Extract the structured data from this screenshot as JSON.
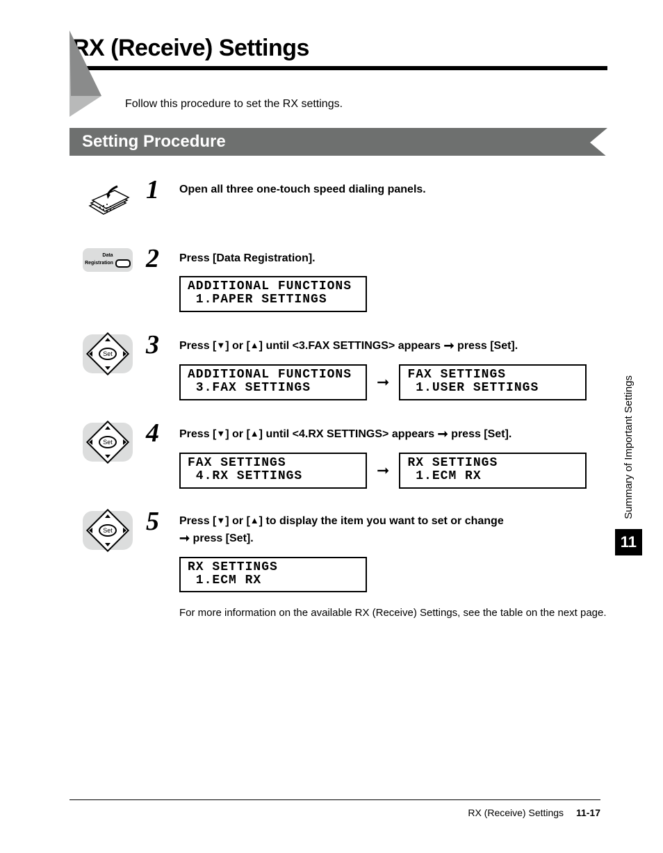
{
  "chapter_title": "RX (Receive) Settings",
  "intro": "Follow this procedure to set the RX settings.",
  "subhead": "Setting Procedure",
  "steps": [
    {
      "num": "1",
      "icon": "panel",
      "text": "Open all three one-touch speed dialing panels.",
      "lcds": []
    },
    {
      "num": "2",
      "icon": "datareg",
      "icon_label_a": "Data",
      "icon_label_b": "Registration",
      "text": "Press [Data Registration].",
      "lcds": [
        {
          "a": "ADDITIONAL FUNCTIONS\n 1.PAPER SETTINGS"
        }
      ]
    },
    {
      "num": "3",
      "icon": "set",
      "icon_center": "Set",
      "text_pre": "Press [",
      "text_mid1": "] or [",
      "text_mid2": "] until <3.FAX SETTINGS> appears ",
      "text_post": " press [Set].",
      "lcds": [
        {
          "a": "ADDITIONAL FUNCTIONS\n 3.FAX SETTINGS",
          "b": "FAX SETTINGS\n 1.USER SETTINGS"
        }
      ]
    },
    {
      "num": "4",
      "icon": "set",
      "icon_center": "Set",
      "text_pre": "Press [",
      "text_mid1": "] or [",
      "text_mid2": "] until <4.RX SETTINGS> appears ",
      "text_post": " press [Set].",
      "lcds": [
        {
          "a": "FAX SETTINGS\n 4.RX SETTINGS",
          "b": "RX SETTINGS\n 1.ECM RX"
        }
      ]
    },
    {
      "num": "5",
      "icon": "set",
      "icon_center": "Set",
      "text_pre": "Press [",
      "text_mid1": "] or [",
      "text_mid2": "] to display the item you want to set or change ",
      "text_post": " press [Set].",
      "lcds": [
        {
          "a": "RX SETTINGS\n 1.ECM RX"
        }
      ],
      "note": "For more information on the available RX (Receive) Settings, see the table on the next page."
    }
  ],
  "glyphs": {
    "down": "▼",
    "up": "▲",
    "arrow": "➞"
  },
  "side": {
    "label": "Summary of Important Settings",
    "num": "11"
  },
  "footer": {
    "title": "RX (Receive) Settings",
    "page": "11-17"
  }
}
